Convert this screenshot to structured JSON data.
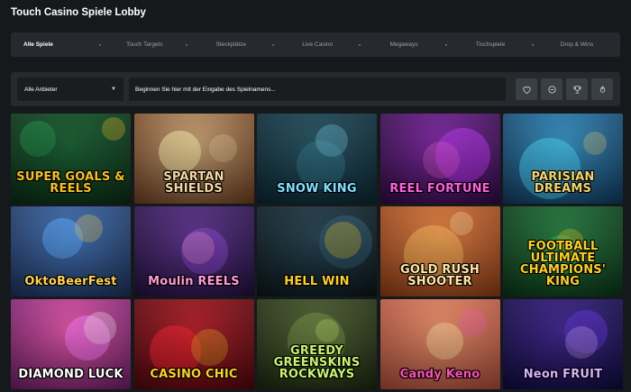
{
  "page": {
    "title": "Touch Casino Spiele Lobby"
  },
  "tabs": [
    {
      "label": "Alle Spiele",
      "active": true
    },
    {
      "label": "Touch Targets"
    },
    {
      "label": "Steckplätze"
    },
    {
      "label": "Live Casino"
    },
    {
      "label": "Megaways"
    },
    {
      "label": "Tischspiele"
    },
    {
      "label": "Drop & Wins"
    }
  ],
  "filters": {
    "provider_selected": "Alle Anbieter",
    "search_placeholder": "Beginnen Sie hier mit der Eingabe des Spielnamens...",
    "buttons": [
      {
        "icon": "heart-icon"
      },
      {
        "icon": "tag-icon"
      },
      {
        "icon": "trophy-icon"
      },
      {
        "icon": "flame-icon"
      }
    ]
  },
  "games": [
    {
      "title": "SUPER GOALS & REELS",
      "colors": [
        "#0f5a2a",
        "#0a2a14"
      ],
      "text": "#f6c21a"
    },
    {
      "title": "SPARTAN SHIELDS",
      "colors": [
        "#c7a172",
        "#6a3b1e"
      ],
      "text": "#f2d7a0"
    },
    {
      "title": "SNOW KING",
      "colors": [
        "#1d4d5c",
        "#0b2430"
      ],
      "text": "#7ee0ff"
    },
    {
      "title": "REEL FORTUNE",
      "colors": [
        "#7b1fa2",
        "#2b0a3d"
      ],
      "text": "#ff5fe1"
    },
    {
      "title": "PARISIAN DREAMS",
      "colors": [
        "#2e8fc4",
        "#10375a"
      ],
      "text": "#f5d36a"
    },
    {
      "title": "OktoBeerFest",
      "colors": [
        "#3a6fb5",
        "#1c2f57"
      ],
      "text": "#ffd34d"
    },
    {
      "title": "Moulin REELS",
      "colors": [
        "#5a2b8c",
        "#1e0f3a"
      ],
      "text": "#ff9ad5"
    },
    {
      "title": "HELL WIN",
      "colors": [
        "#1c3b4a",
        "#0a1418"
      ],
      "text": "#ffd21a"
    },
    {
      "title": "GOLD RUSH SHOOTER",
      "colors": [
        "#e07b3a",
        "#8a3a15"
      ],
      "text": "#ffe6a8"
    },
    {
      "title": "FOOTBALL ULTIMATE CHAMPIONS' KING",
      "colors": [
        "#1e7a3a",
        "#0a3016"
      ],
      "text": "#ffd21a"
    },
    {
      "title": "DIAMOND LUCK",
      "colors": [
        "#e24ea7",
        "#6a1d64"
      ],
      "text": "#ffffff"
    },
    {
      "title": "CASINO CHIC",
      "colors": [
        "#b3141e",
        "#4a060b"
      ],
      "text": "#ffd21a"
    },
    {
      "title": "GREEDY GREENSKINS ROCKWAYS",
      "colors": [
        "#4a5d2a",
        "#1a2510"
      ],
      "text": "#c8f36a"
    },
    {
      "title": "Candy Keno",
      "colors": [
        "#e98a63",
        "#a84a3a"
      ],
      "text": "#ff4fb8"
    },
    {
      "title": "Neon FRUIT",
      "colors": [
        "#3a1c8c",
        "#0c0a3a"
      ],
      "text": "#d6b3ff"
    }
  ]
}
